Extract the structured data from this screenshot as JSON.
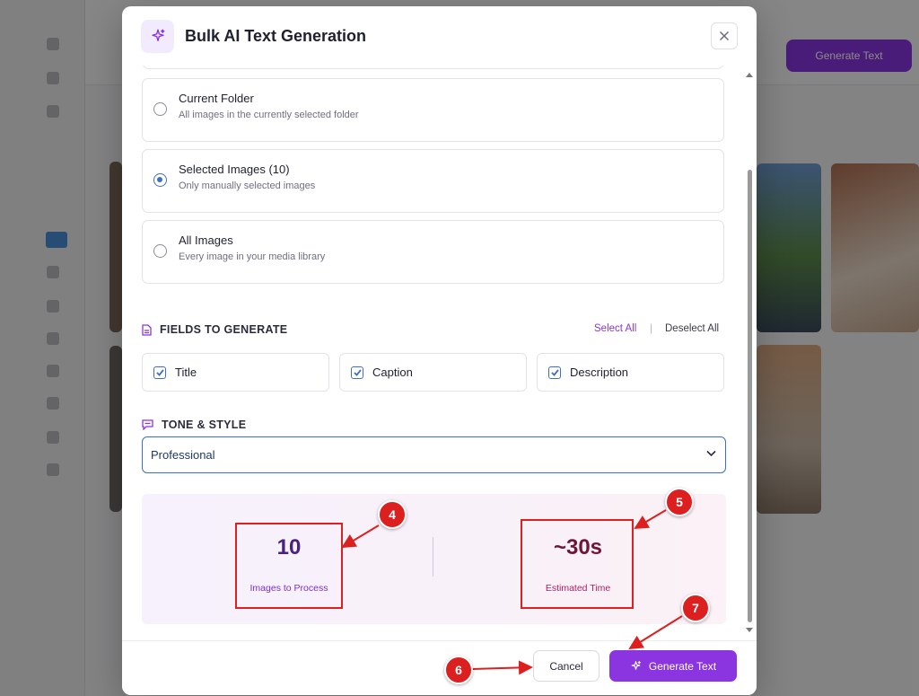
{
  "modal": {
    "title": "Bulk AI Text Generation",
    "header_icon": "sparkle-icon",
    "close_icon": "close-icon"
  },
  "scope_options": [
    {
      "label": "Current Folder",
      "description": "All images in the currently selected folder",
      "selected": false
    },
    {
      "label": "Selected Images (10)",
      "description": "Only manually selected images",
      "selected": true
    },
    {
      "label": "All Images",
      "description": "Every image in your media library",
      "selected": false
    }
  ],
  "fields_section": {
    "heading": "FIELDS TO GENERATE",
    "icon": "document-icon",
    "select_all": "Select All",
    "separator": "|",
    "deselect_all": "Deselect All",
    "fields": [
      {
        "label": "Title",
        "checked": true
      },
      {
        "label": "Caption",
        "checked": true
      },
      {
        "label": "Description",
        "checked": true
      }
    ]
  },
  "tone_section": {
    "heading": "TONE & STYLE",
    "icon": "message-icon",
    "selected": "Professional"
  },
  "summary": {
    "images_value": "10",
    "images_label": "Images to Process",
    "time_value": "~30s",
    "time_label": "Estimated Time"
  },
  "footer": {
    "cancel": "Cancel",
    "generate": "Generate Text"
  },
  "background": {
    "top_button": "Generate Text"
  },
  "annotations": [
    "4",
    "5",
    "6",
    "7"
  ],
  "colors": {
    "accent": "#8a35e0",
    "radio_checkbox": "#3f6fc0",
    "images_value": "#4a2080",
    "time_value": "#6e1538",
    "images_label": "#7a2fd0",
    "time_label": "#b02060",
    "annotation_red": "#dc1f1f"
  }
}
